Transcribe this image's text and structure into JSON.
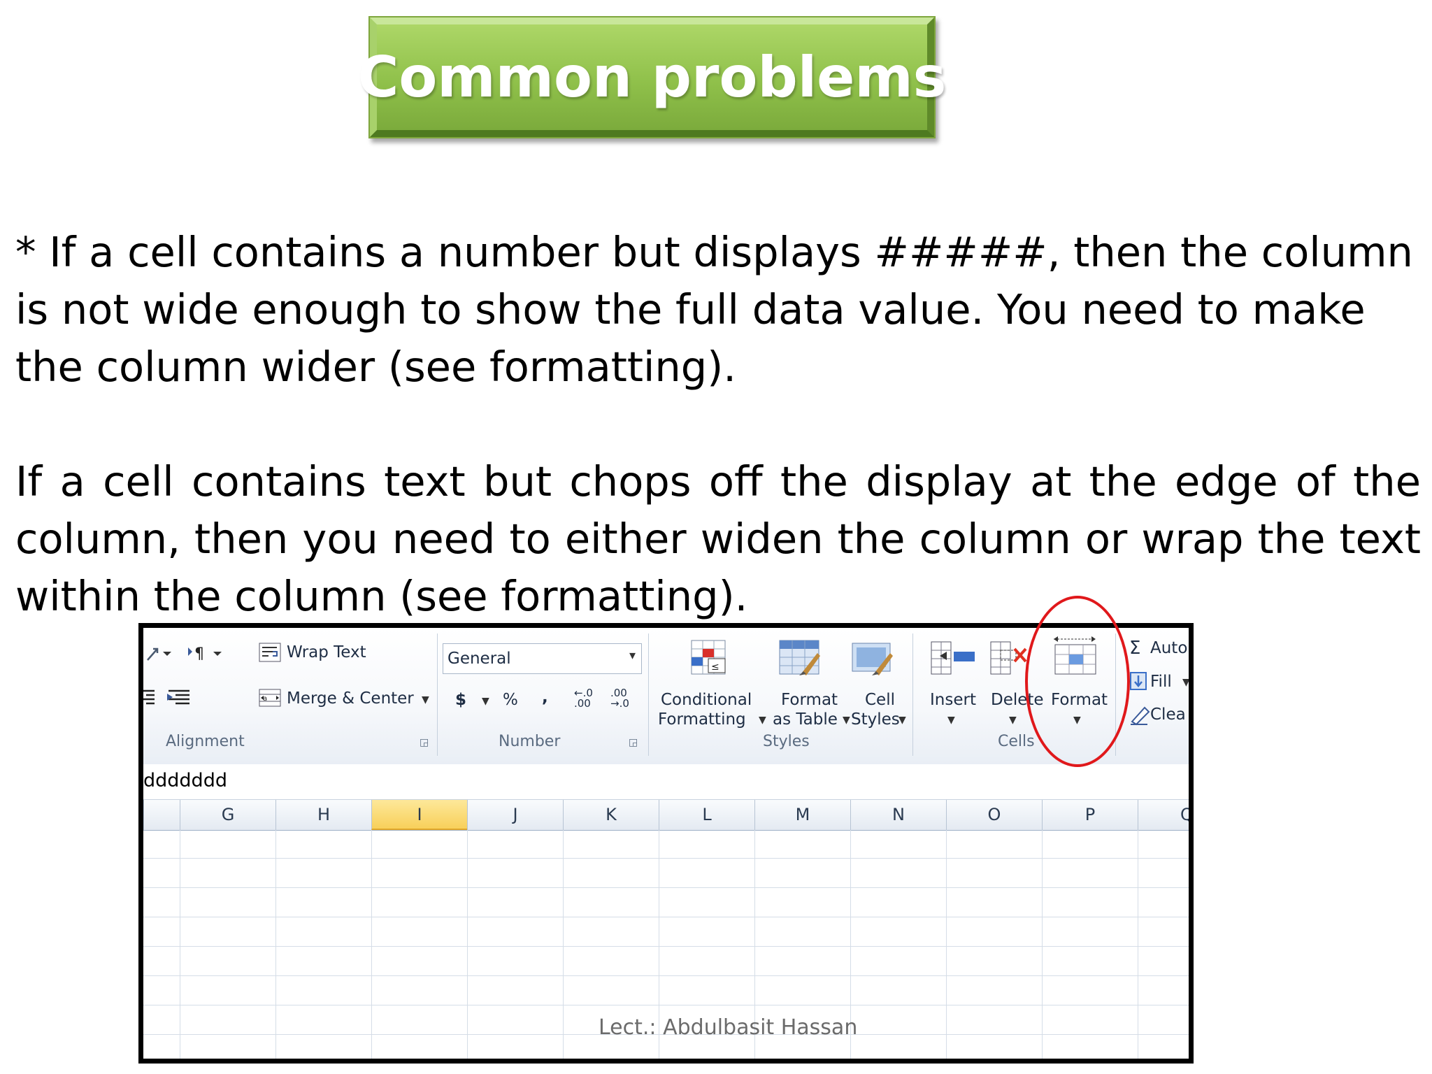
{
  "title": "Common problems",
  "paragraph1": "* If a cell contains a number but displays #####, then the column is not wide enough to show the full data value. You need to make the column wider (see formatting).",
  "paragraph2": "If a cell contains text but chops off the display at the edge of the column, then you need to either widen the column or wrap the text within the column (see formatting).",
  "ribbon": {
    "wrap_text": "Wrap Text",
    "merge_center": "Merge & Center",
    "number_format": "General",
    "currency": "$",
    "percent": "%",
    "comma": ",",
    "inc_decimal": "←.0 .00",
    "dec_decimal": ".00 →.0",
    "conditional_formatting_l1": "Conditional",
    "conditional_formatting_l2": "Formatting",
    "format_as_table_l1": "Format",
    "format_as_table_l2": "as Table",
    "cell_styles_l1": "Cell",
    "cell_styles_l2": "Styles",
    "insert": "Insert",
    "delete": "Delete",
    "format": "Format",
    "autosum": "Auto",
    "fill": "Fill",
    "clear": "Clea",
    "groups": {
      "alignment": "Alignment",
      "number": "Number",
      "styles": "Styles",
      "cells": "Cells"
    }
  },
  "formula_value": "ddddddd",
  "columns": [
    "G",
    "H",
    "I",
    "J",
    "K",
    "L",
    "M",
    "N",
    "O",
    "P",
    "Q"
  ],
  "selected_column": "I",
  "footer": "Lect.: Abdulbasit Hassan",
  "colors": {
    "title_green": "#8fc04a",
    "highlight_circle": "#e0181b",
    "selected_col": "#f8d05a"
  },
  "icons": [
    "wrap-text-icon",
    "merge-center-icon",
    "conditional-formatting-icon",
    "format-as-table-icon",
    "cell-styles-icon",
    "insert-icon",
    "delete-icon",
    "format-icon",
    "autosum-icon",
    "fill-icon",
    "clear-icon"
  ]
}
